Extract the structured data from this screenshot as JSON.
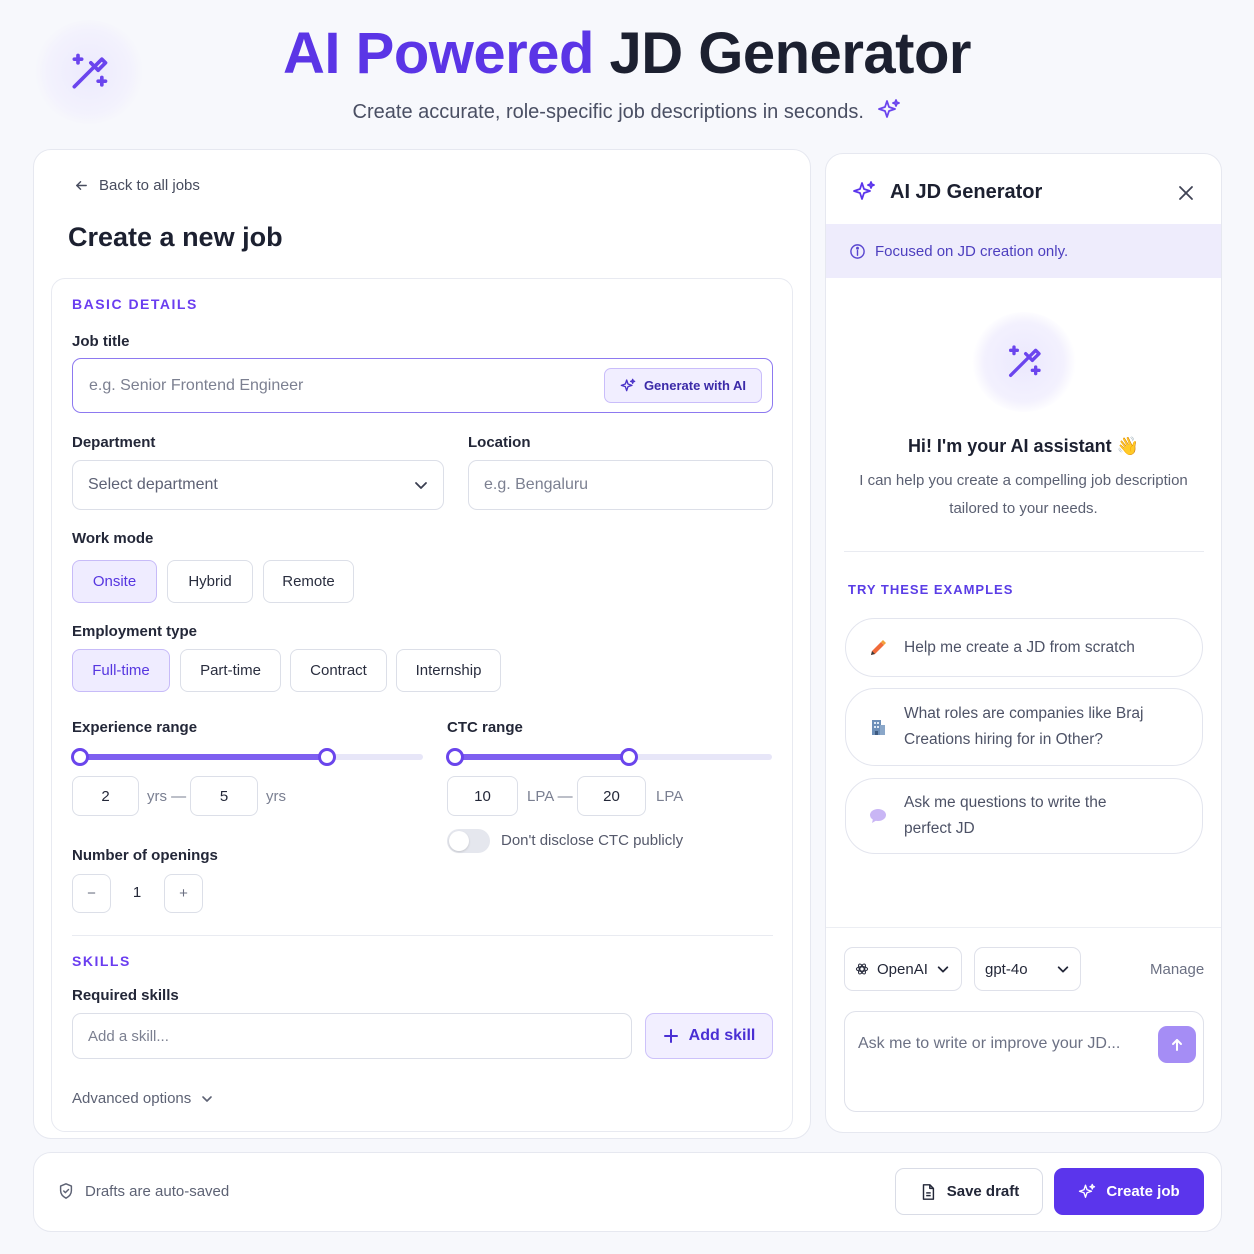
{
  "header": {
    "title_accent": "AI Powered",
    "title_rest": "JD Generator",
    "subtitle": "Create accurate, role-specific job descriptions in seconds."
  },
  "form": {
    "back_link": "Back to all jobs",
    "page_title": "Create a new job",
    "basic_section": "BASIC DETAILS",
    "job_title_label": "Job title",
    "job_title_placeholder": "e.g. Senior Frontend Engineer",
    "generate_button": "Generate with AI",
    "department_label": "Department",
    "department_value": "Select department",
    "location_label": "Location",
    "location_placeholder": "e.g. Bengaluru",
    "work_mode_label": "Work mode",
    "work_modes": [
      "Onsite",
      "Hybrid",
      "Remote"
    ],
    "work_mode_selected": "Onsite",
    "employment_label": "Employment type",
    "employment_types": [
      "Full-time",
      "Part-time",
      "Contract",
      "Internship"
    ],
    "employment_selected": "Full-time",
    "experience_label": "Experience range",
    "experience_min": "2",
    "experience_max": "5",
    "experience_unit_mid": "yrs —",
    "experience_unit_end": "yrs",
    "experience_fill": {
      "from": 0.0,
      "to": 0.72
    },
    "ctc_label": "CTC range",
    "ctc_min": "10",
    "ctc_max": "20",
    "ctc_unit_mid": "LPA —",
    "ctc_unit_end": "LPA",
    "ctc_fill": {
      "from": 0.0,
      "to": 0.55
    },
    "ctc_toggle_label": "Don't disclose CTC publicly",
    "ctc_toggle_on": false,
    "openings_label": "Number of openings",
    "openings_value": "1",
    "openings_minus": "−",
    "openings_plus": "+",
    "skills_section": "SKILLS",
    "required_skills_label": "Required skills",
    "skill_placeholder": "Add a skill...",
    "add_skill_button": "Add skill",
    "advanced_options": "Advanced options"
  },
  "assistant": {
    "panel_title": "AI JD Generator",
    "close_icon": "close-icon",
    "banner": "Focused on JD creation only.",
    "greeting": "Hi! I'm your AI assistant",
    "greeting_emoji": "👋",
    "help_text": "I can help you create a compelling job description tailored to your needs.",
    "examples_label": "TRY THESE EXAMPLES",
    "examples": [
      {
        "icon": "pencil-icon",
        "text": "Help me create a JD from scratch"
      },
      {
        "icon": "building-icon",
        "text": "What roles are companies like Braj Creations hiring for in Other?"
      },
      {
        "icon": "chat-bubble-icon",
        "text": "Ask me questions to write the perfect JD"
      }
    ],
    "provider": "OpenAI",
    "model": "gpt-4o",
    "manage": "Manage",
    "chat_placeholder": "Ask me to write or improve your JD..."
  },
  "footer": {
    "autosave_note": "Drafts are auto-saved",
    "save_draft": "Save draft",
    "create_job": "Create job"
  },
  "colors": {
    "accent": "#5b35ec",
    "accent_light": "#efecff",
    "title_dark": "#1c2030"
  }
}
